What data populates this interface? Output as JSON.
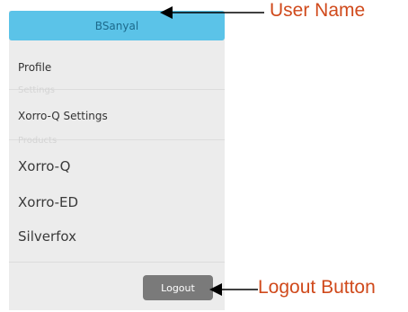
{
  "menu": {
    "username": "BSanyal",
    "items": [
      {
        "label": "Profile"
      },
      {
        "label": "Xorro-Q Settings"
      }
    ],
    "sections": {
      "settings": "Settings",
      "products": "Products"
    },
    "products": [
      {
        "label": "Xorro-Q"
      },
      {
        "label": "Xorro-ED"
      },
      {
        "label": "Silverfox"
      }
    ],
    "logout_label": "Logout"
  },
  "annotations": {
    "user_name": "User Name",
    "logout_button": "Logout Button"
  },
  "colors": {
    "user_bar": "#5bc3e8",
    "menu_bg": "#ececec",
    "logout_bg": "#7a7a7a",
    "annotation": "#d04a1c"
  }
}
